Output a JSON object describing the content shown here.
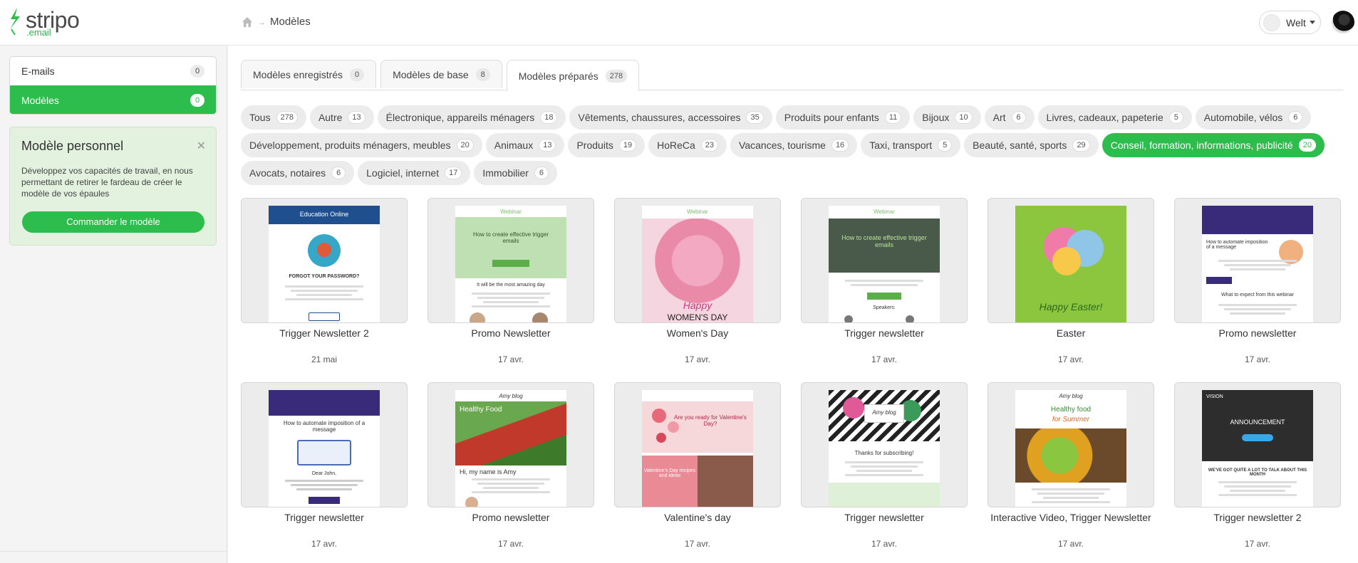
{
  "header": {
    "logo_text": "stripo",
    "logo_sub": ".email",
    "breadcrumb": "Modèles",
    "user_name": "Welt"
  },
  "sidebar": {
    "nav": [
      {
        "label": "E-mails",
        "count": "0"
      },
      {
        "label": "Modèles",
        "count": "0"
      }
    ],
    "promo": {
      "title": "Modèle personnel",
      "text": "Développez vos capacités de travail, en nous permettant de retirer le fardeau de créer le modèle de vos épaules",
      "button": "Commander le modèle"
    }
  },
  "tabs": [
    {
      "label": "Modèles enregistrés",
      "count": "0"
    },
    {
      "label": "Modèles de base",
      "count": "8"
    },
    {
      "label": "Modèles préparés",
      "count": "278"
    }
  ],
  "categories": [
    {
      "label": "Tous",
      "count": "278"
    },
    {
      "label": "Autre",
      "count": "13"
    },
    {
      "label": "Électronique, appareils ménagers",
      "count": "18"
    },
    {
      "label": "Vêtements, chaussures, accessoires",
      "count": "35"
    },
    {
      "label": "Produits pour enfants",
      "count": "11"
    },
    {
      "label": "Bijoux",
      "count": "10"
    },
    {
      "label": "Art",
      "count": "6"
    },
    {
      "label": "Livres, cadeaux, papeterie",
      "count": "5"
    },
    {
      "label": "Automobile, vélos",
      "count": "6"
    },
    {
      "label": "Développement, produits ménagers, meubles",
      "count": "20"
    },
    {
      "label": "Animaux",
      "count": "13"
    },
    {
      "label": "Produits",
      "count": "19"
    },
    {
      "label": "HoReCa",
      "count": "23"
    },
    {
      "label": "Vacances, tourisme",
      "count": "16"
    },
    {
      "label": "Taxi, transport",
      "count": "5"
    },
    {
      "label": "Beauté, santé, sports",
      "count": "29"
    },
    {
      "label": "Conseil, formation, informations, publicité",
      "count": "20"
    },
    {
      "label": "Avocats, notaires",
      "count": "6"
    },
    {
      "label": "Logiciel, internet",
      "count": "17"
    },
    {
      "label": "Immobilier",
      "count": "6"
    }
  ],
  "templates": [
    {
      "title": "Trigger Newsletter 2",
      "date": "21 mai",
      "theme": "education",
      "thumb_texts": [
        "Education Online",
        "FORGOT YOUR PASSWORD?"
      ]
    },
    {
      "title": "Promo Newsletter",
      "date": "17 avr.",
      "theme": "webinar-green",
      "thumb_texts": [
        "Webinar",
        "How to create effective trigger emails",
        "It will be the most amazing day"
      ]
    },
    {
      "title": "Women's Day",
      "date": "17 avr.",
      "theme": "womens-day",
      "thumb_texts": [
        "Webinar",
        "Happy",
        "WOMEN'S DAY"
      ]
    },
    {
      "title": "Trigger newsletter",
      "date": "17 avr.",
      "theme": "webinar-dark",
      "thumb_texts": [
        "Webinar",
        "How to create effective trigger emails",
        "Speakers:"
      ]
    },
    {
      "title": "Easter",
      "date": "17 avr.",
      "theme": "easter",
      "thumb_texts": [
        "Happy Easter!"
      ]
    },
    {
      "title": "Promo newsletter",
      "date": "17 avr.",
      "theme": "purple-webinar",
      "thumb_texts": [
        "How to automate imposition of a message",
        "What to expect from this webinar"
      ]
    },
    {
      "title": "Trigger newsletter",
      "date": "17 avr.",
      "theme": "purple-laptop",
      "thumb_texts": [
        "How to automate imposition of a message",
        "Dear John,"
      ]
    },
    {
      "title": "Promo newsletter",
      "date": "17 avr.",
      "theme": "healthy-food",
      "thumb_texts": [
        "Amy blog",
        "Healthy Food",
        "Hi, my name is Amy"
      ]
    },
    {
      "title": "Valentine's day",
      "date": "17 avr.",
      "theme": "valentine",
      "thumb_texts": [
        "Are you ready for Valentine's Day?",
        "Valentine's Day recipes and ideas"
      ]
    },
    {
      "title": "Trigger newsletter",
      "date": "17 avr.",
      "theme": "tropical",
      "thumb_texts": [
        "Amy blog",
        "Thanks for subscribing!"
      ]
    },
    {
      "title": "Interactive Video, Trigger Newsletter",
      "date": "17 avr.",
      "theme": "summer-food",
      "thumb_texts": [
        "Amy blog",
        "Healthy food",
        "for Summer"
      ]
    },
    {
      "title": "Trigger newsletter 2",
      "date": "17 avr.",
      "theme": "announcement",
      "thumb_texts": [
        "VISION",
        "ANNOUNCEMENT",
        "WE'VE GOT QUITE A LOT TO TALK ABOUT THIS MONTH"
      ]
    }
  ],
  "colors": {
    "accent": "#2cbd4d",
    "promo_bg": "#e2f2df"
  }
}
